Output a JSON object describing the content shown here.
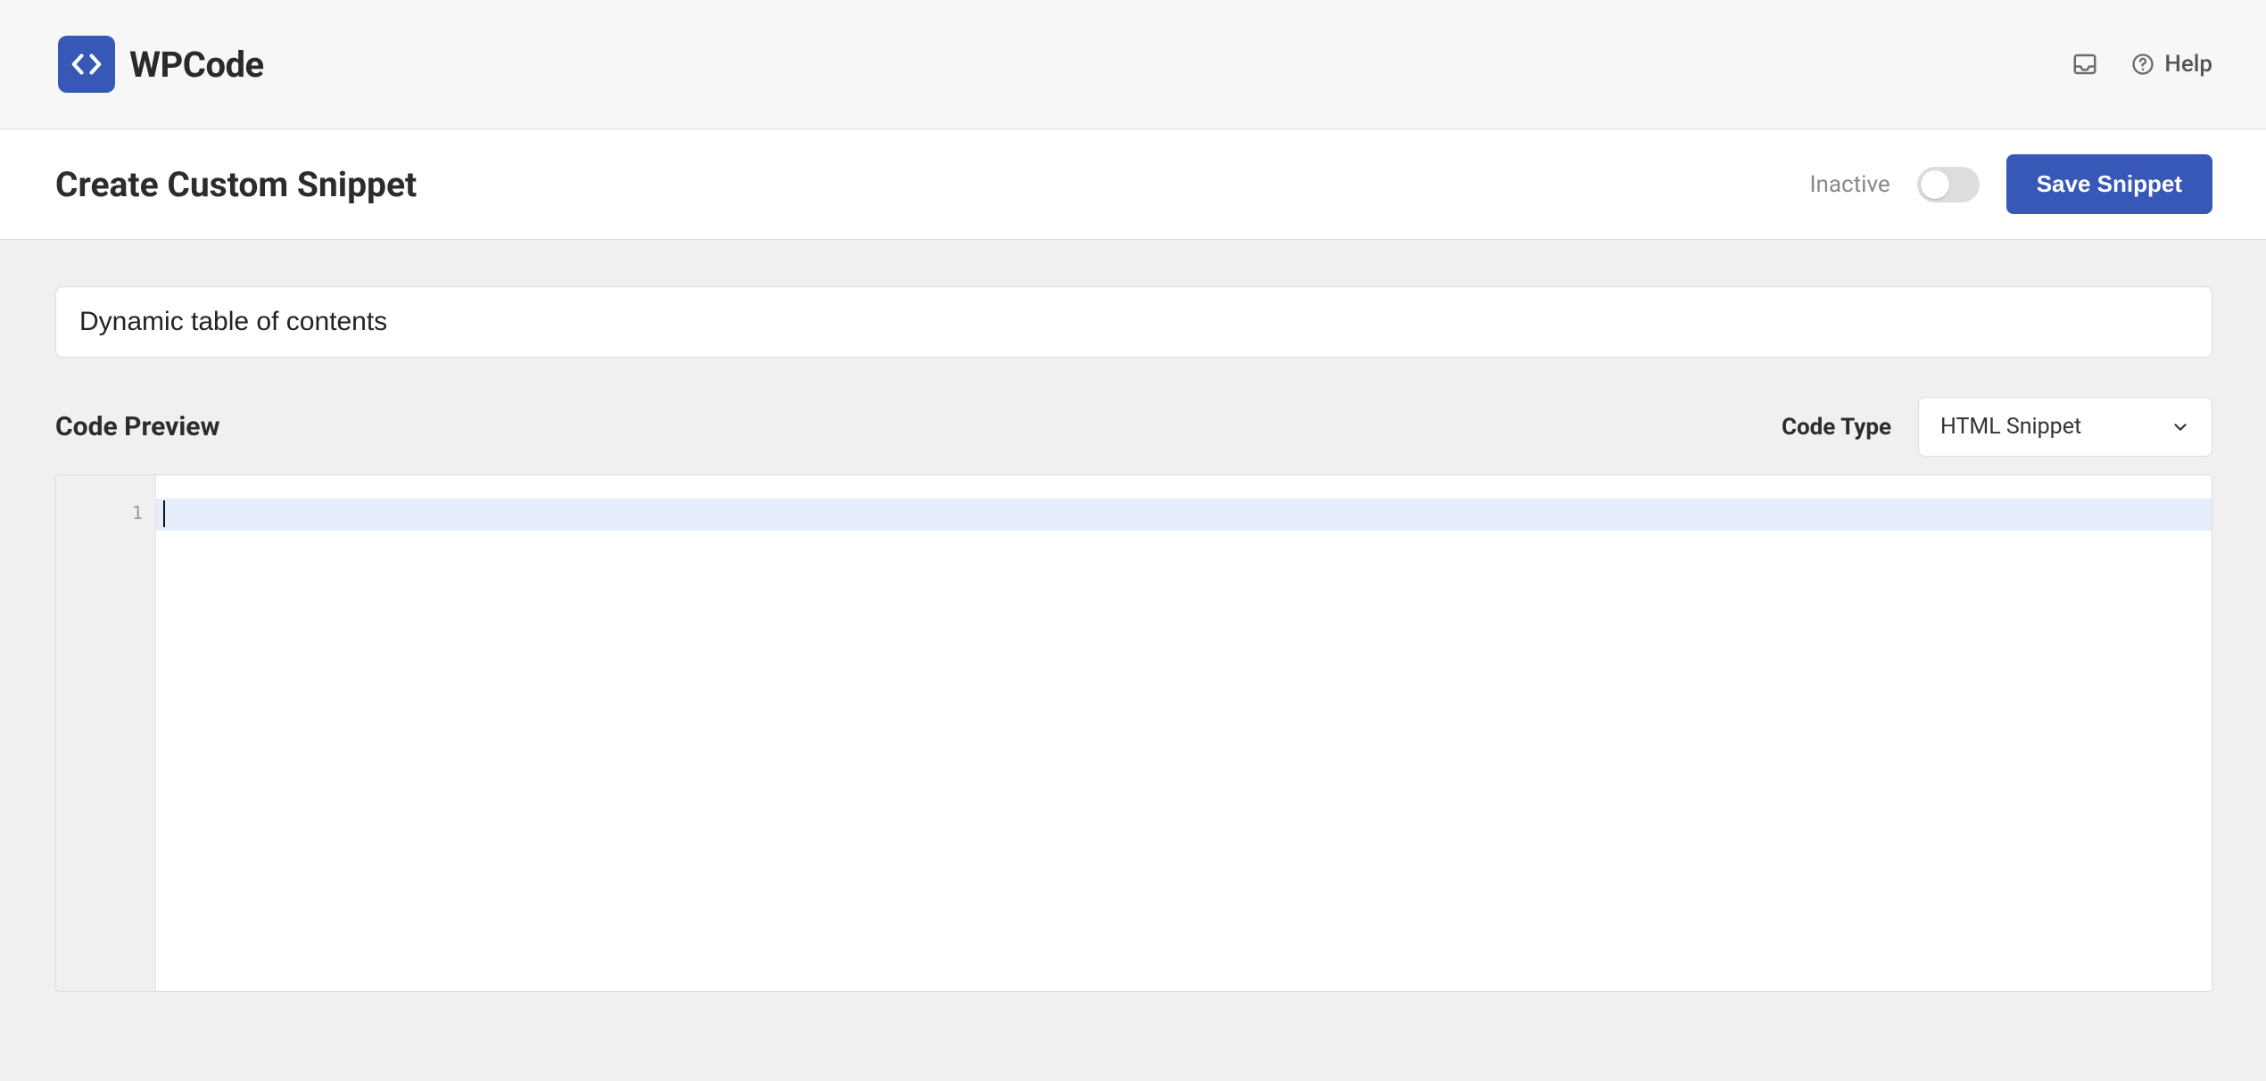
{
  "brand": {
    "name": "WPCode"
  },
  "header": {
    "help_label": "Help"
  },
  "action": {
    "page_title": "Create Custom Snippet",
    "status_label": "Inactive",
    "save_label": "Save Snippet"
  },
  "form": {
    "title_value": "Dynamic table of contents"
  },
  "code_preview": {
    "label": "Code Preview",
    "code_type_label": "Code Type",
    "code_type_value": "HTML Snippet",
    "gutter": {
      "line1": "1"
    }
  }
}
